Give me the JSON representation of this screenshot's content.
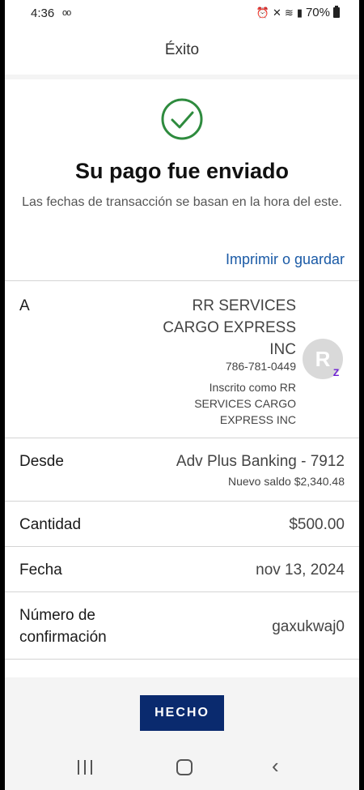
{
  "status_bar": {
    "time": "4:36",
    "battery": "70%",
    "icons": [
      "voicemail-icon",
      "alarm-icon",
      "mute-icon",
      "wifi-icon",
      "signal-icon",
      "battery-icon"
    ]
  },
  "header": {
    "title": "Éxito"
  },
  "success": {
    "icon": "check-circle-icon",
    "title": "Su pago fue enviado",
    "subtitle": "Las fechas de transacción se basan en la hora del este."
  },
  "print_link": "Imprimir o guardar",
  "details": {
    "to_label": "A",
    "payee_name": "RR SERVICES CARGO EXPRESS INC",
    "payee_phone": "786-781-0449",
    "payee_enrolled": "Inscrito como RR SERVICES CARGO EXPRESS INC",
    "avatar_letter": "R",
    "from_label": "Desde",
    "from_account": "Adv Plus Banking - 7912",
    "new_balance": "Nuevo saldo $2,340.48",
    "amount_label": "Cantidad",
    "amount": "$500.00",
    "date_label": "Fecha",
    "date": "nov 13, 2024",
    "confirmation_label": "Número de confirmación",
    "confirmation": "gaxukwaj0"
  },
  "done_button": "HECHO",
  "colors": {
    "accent_green": "#2e8b3e",
    "link_blue": "#1a5aa6",
    "button_navy": "#0a2a6e",
    "zelle_purple": "#6d1ed4"
  }
}
